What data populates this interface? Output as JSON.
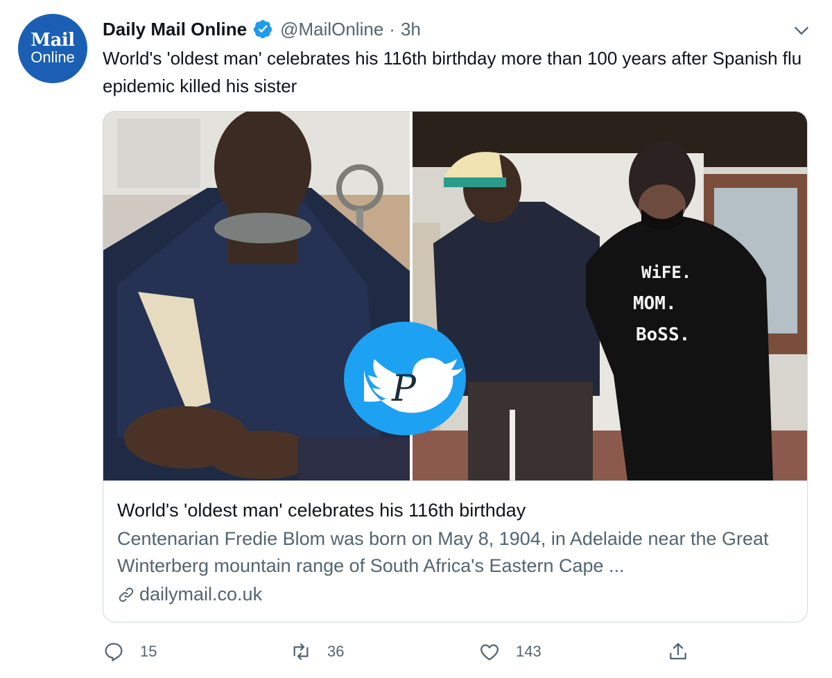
{
  "account": {
    "avatar_line1": "Mail",
    "avatar_line2": "Online",
    "display_name": "Daily Mail Online",
    "handle": "@MailOnline",
    "separator": "·",
    "time": "3h"
  },
  "tweet": {
    "text": "World's 'oldest man' celebrates his 116th birthday more than 100 years after Spanish flu epidemic killed his sister"
  },
  "media": {
    "shirt_line1": "WiFE.",
    "shirt_line2": "MOM.",
    "shirt_line3": "BoSS.",
    "watermark_letter": "P"
  },
  "card": {
    "title": "World's 'oldest man' celebrates his 116th birthday",
    "description": "Centenarian Fredie Blom was born on May 8, 1904, in Adelaide near the Great Winterberg mountain range of South Africa's Eastern Cape ...",
    "domain": "dailymail.co.uk"
  },
  "actions": {
    "reply_count": "15",
    "retweet_count": "36",
    "like_count": "143"
  },
  "colors": {
    "brand_blue": "#1a5fb4",
    "verified_blue": "#1d9bf0",
    "secondary_text": "#536471",
    "border": "#cfd9de"
  }
}
